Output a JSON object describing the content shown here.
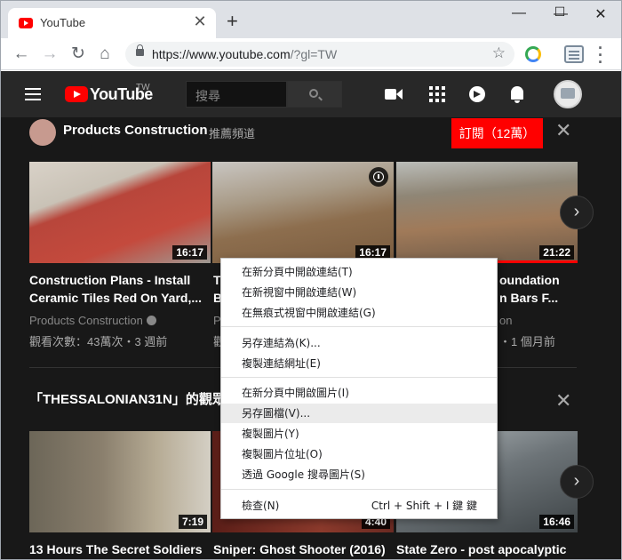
{
  "browser": {
    "tab_title": "YouTube",
    "tab_close": "✕",
    "new_tab": "+",
    "win_min": "—",
    "win_max": "☐",
    "win_close": "✕",
    "back": "←",
    "forward": "→",
    "reload": "↻",
    "home": "⌂",
    "url_host": "https://www.youtube.com",
    "url_path": "/?gl=TW",
    "star": "☆"
  },
  "youtube": {
    "wordmark": "YouTube",
    "region": "TW",
    "search_placeholder": "搜尋",
    "shelf1": {
      "channel": "Products Construction",
      "tag": "推薦頻道",
      "subscribe": "訂閱（12萬）",
      "close": "✕",
      "next": "›",
      "videos": [
        {
          "title": "Construction Plans - Install Ceramic Tiles Red On Yard,...",
          "title_l1": "Construction Plans - Install",
          "title_l2": "Ceramic Tiles Red On Yard,...",
          "duration": "16:17",
          "channel": "Products Construction",
          "meta": "觀看次數：43萬次・3 週前"
        },
        {
          "title_l1": "T",
          "title_l2": "B",
          "duration": "16:17",
          "channel": "P",
          "meta": "觀"
        },
        {
          "title_l1": "oundation",
          "title_l2": "n Bars F...",
          "duration": "21:22",
          "channel": "on",
          "meta": "・1 個月前"
        }
      ]
    },
    "shelf2": {
      "title": "「THESSALONIAN31N」的觀眾",
      "close": "✕",
      "next": "›",
      "videos": [
        {
          "title": "13 Hours The Secret Soldiers",
          "duration": "7:19"
        },
        {
          "title": "Sniper: Ghost Shooter (2016)",
          "duration": "4:40"
        },
        {
          "title": "State Zero - post apocalyptic",
          "duration": "16:46"
        }
      ]
    }
  },
  "context_menu": {
    "items": [
      {
        "label": "在新分頁中開啟連結(T)"
      },
      {
        "label": "在新視窗中開啟連結(W)"
      },
      {
        "label": "在無痕式視窗中開啟連結(G)"
      },
      {
        "label": "另存連結為(K)..."
      },
      {
        "label": "複製連結網址(E)"
      },
      {
        "label": "在新分頁中開啟圖片(I)"
      },
      {
        "label": "另存圖檔(V)..."
      },
      {
        "label": "複製圖片(Y)"
      },
      {
        "label": "複製圖片位址(O)"
      },
      {
        "label": "透過 Google 搜尋圖片(S)"
      },
      {
        "label": "檢查(N)",
        "shortcut": "Ctrl + Shift + I 鍵 鍵"
      }
    ]
  }
}
